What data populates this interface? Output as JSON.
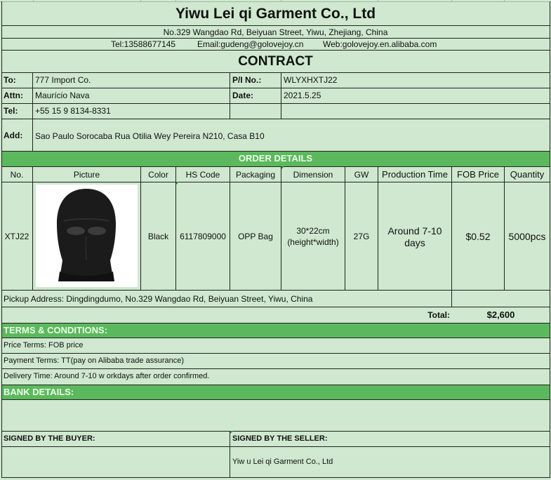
{
  "header": {
    "company": "Yiwu Lei qi Garment Co., Ltd",
    "address": "No.329 Wangdao Rd, Beiyuan Street, Yiwu, Zhejiang, China",
    "tel": "Tel:13588677145",
    "email": "Email:gudeng@golovejoy.cn",
    "web": "Web:golovejoy.en.alibaba.com",
    "doc_title": "CONTRACT"
  },
  "buyer": {
    "to_label": "To:",
    "to": "777 Import Co.",
    "attn_label": "Attn:",
    "attn": "Maurício Nava",
    "tel_label": "Tel:",
    "tel": "+55 15 9 8134-8331",
    "add_label": "Add:",
    "add": "Sao Paulo Sorocaba  Rua Otilia Wey Pereira N210, Casa B10"
  },
  "invoice": {
    "pi_label": "P/I No.:",
    "pi": "WLYXHXTJ22",
    "date_label": "Date:",
    "date": "2021.5.25"
  },
  "order": {
    "section_title": "ORDER DETAILS",
    "columns": [
      "No.",
      "Picture",
      "Color",
      "HS Code",
      "Packaging",
      "Dimension",
      "GW",
      "Production Time",
      "FOB Price",
      "Quantity"
    ],
    "row": {
      "no": "XTJ22",
      "color": "Black",
      "hs_code": "6117809000",
      "packaging": "OPP Bag",
      "dimension_1": "30*22cm",
      "dimension_2": "(height*width)",
      "gw": "27G",
      "production_1": "Around 7-10",
      "production_2": "days",
      "fob_price": "$0.52",
      "quantity": "5000pcs"
    },
    "pickup": "Pickup Address: Dingdingdumo, No.329 Wangdao Rd, Beiyuan Street, Yiwu, China",
    "total_label": "Total:",
    "total": "$2,600"
  },
  "terms": {
    "title": "TERMS & CONDITIONS:",
    "price": "Price Terms: FOB price",
    "payment": "Payment Terms: TT(pay on Alibaba trade assurance)",
    "delivery": "Delivery Time: Around 7-10 w orkdays after order confirmed."
  },
  "bank": {
    "title": "BANK DETAILS:"
  },
  "signature": {
    "buyer_label": "SIGNED BY THE BUYER:",
    "seller_label": "SIGNED BY THE SELLER:",
    "seller_name": "Yiw u Lei qi Garment Co., Ltd"
  },
  "colors": {
    "sheet_bg": "#cfe8cf",
    "band_green": "#5cb85c",
    "line": "#222222"
  },
  "icons": {
    "product": "balaclava-mask-icon"
  }
}
